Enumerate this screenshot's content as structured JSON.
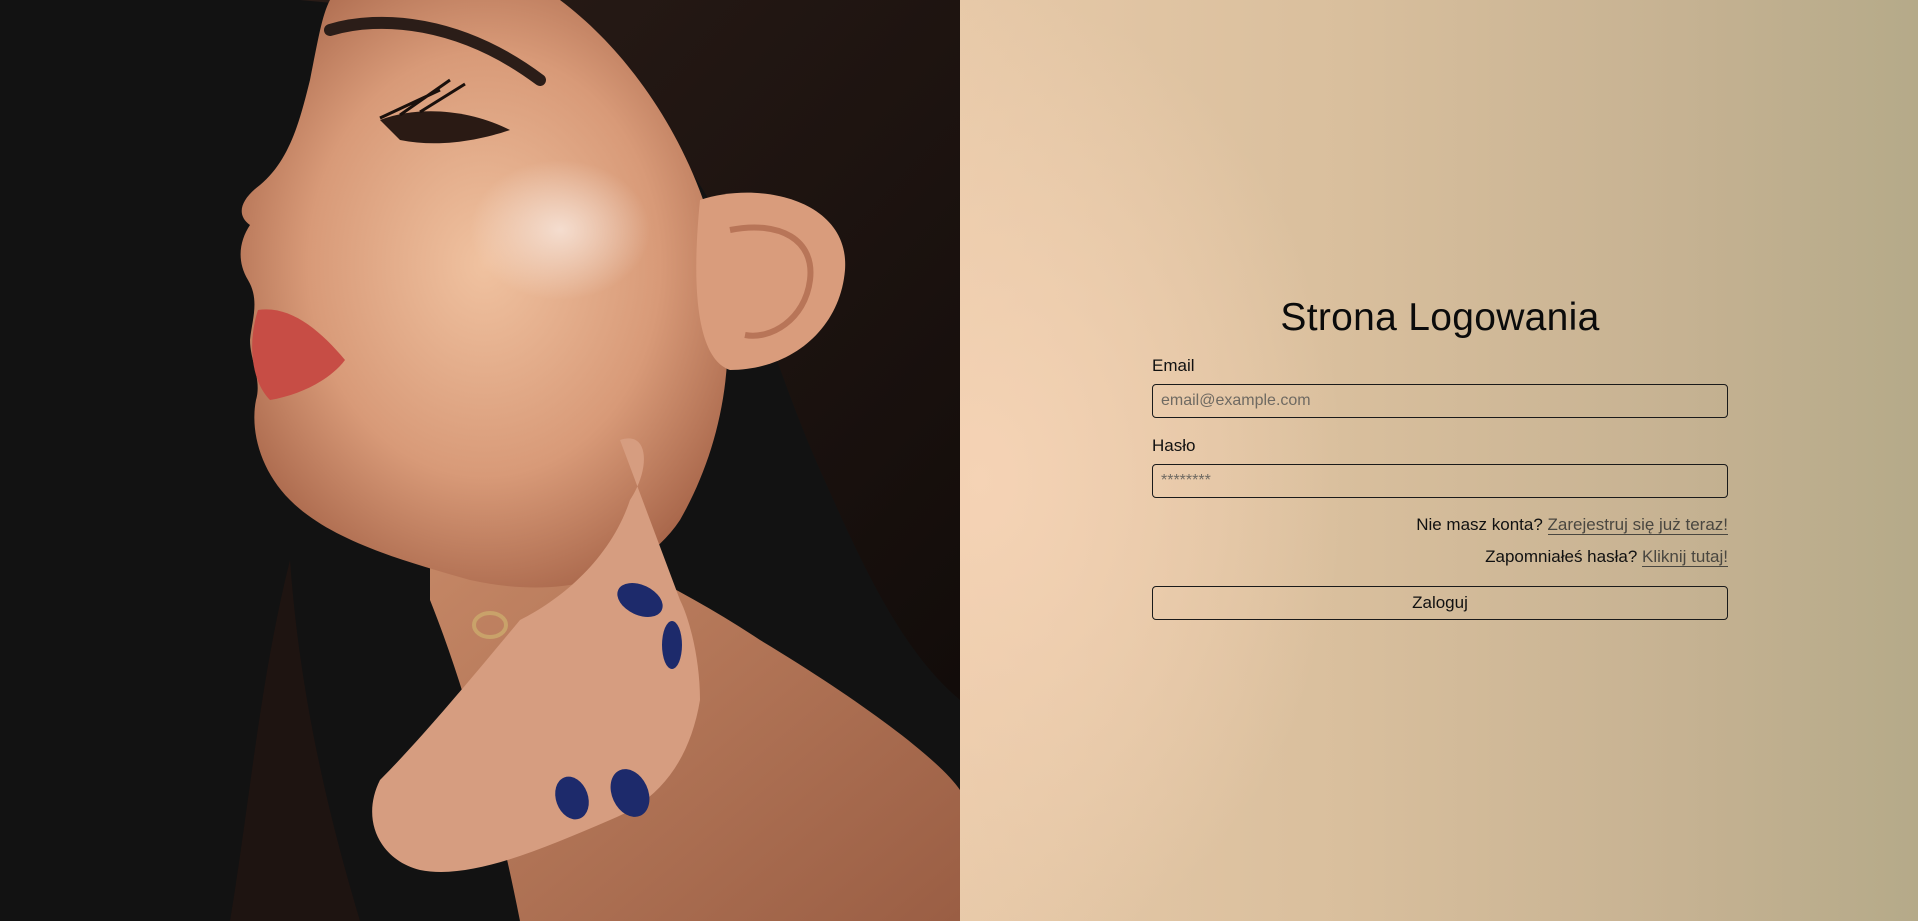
{
  "photo": {
    "description_icon": "portrait-photo"
  },
  "login": {
    "title": "Strona Logowania",
    "email": {
      "label": "Email",
      "placeholder": "email@example.com",
      "value": ""
    },
    "password": {
      "label": "Hasło",
      "placeholder": "********",
      "value": ""
    },
    "register": {
      "prompt": "Nie masz konta?",
      "link": "Zarejestruj się już teraz!"
    },
    "forgot": {
      "prompt": "Zapomniałeś hasła?",
      "link": "Kliknij tutaj!"
    },
    "submit_label": "Zaloguj"
  },
  "colors": {
    "accent_text": "#111111",
    "link": "#4a4740",
    "panel_warm": "#f5d3b5",
    "panel_cool": "#b5aa89",
    "photo_bg": "#121212"
  }
}
